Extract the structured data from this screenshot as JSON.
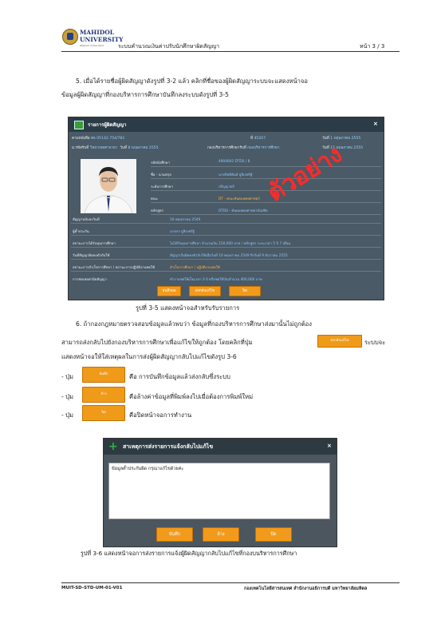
{
  "header": {
    "university_line1": "MAHIDOL",
    "university_line2": "UNIVERSITY",
    "university_tagline": "Wisdom of the Land",
    "doc_title": "ระบบคำนวณเงินค่าปรับนักศึกษาผิดสัญญา",
    "page_number": "หน้า 3 / 3"
  },
  "section5": {
    "line1": "5. เมื่อได้รายชื่อผู้ผิดสัญญาดังรูปที่ 3-2 แล้ว คลิกที่ชื่อของผู้ผิดสัญญาระบบจะแสดงหน้าจอ",
    "line2": "ข้อมูลผู้ผิดสัญญาที่กองบริหารการศึกษาบันทึกลงระบบดังรูปที่ 3-5"
  },
  "dialog1": {
    "title": "รายการผู้ผิดสัญญา",
    "close": "×",
    "doc_label": "ตามหนังสือ",
    "doc_value": "ศธ 05142.754/781",
    "no_label": "ที่",
    "no_value": "45207",
    "date1_label": "วันที่",
    "date1_value": "1 พฤษภาคม 2555",
    "receive_label": "ม.รหัสรับที่",
    "receive_value": "วิทยาเขตศาลายา",
    "date2_label": "วันที่",
    "date2_value": "8 พฤษภาคม 2555",
    "dept_label": "กองบริหารการศึกษารับที่",
    "dept_value": "กองบริหารการศึกษา",
    "date3_label": "วันที่",
    "date3_value": "15 พฤษภาคม 2555",
    "student_rows": [
      {
        "label": "รหัสนักศึกษา",
        "value": "4904002 DTDS / 8"
      },
      {
        "label": "ชื่อ - นามสกุล",
        "value": "นายกิตติพันธ์ ธูสิเกศรัฐ์"
      },
      {
        "label": "ระดับการศึกษา",
        "value": "ปริญญาตรี"
      },
      {
        "label": "คณะ",
        "value": "DT - คณะทันตแพทยศาสตร์"
      },
      {
        "label": "หลักสูตร",
        "value": "DTDS - ทันตแพทยศาสตรบัณฑิต"
      }
    ],
    "contract_rows": [
      {
        "label": "สัญญาฉบับลงวันที่",
        "value": "10 พฤษภาคม 2549"
      },
      {
        "label": "ผู้ค้ำประกัน",
        "value": "นายกร ธูสิเกศรัฐ์"
      },
      {
        "label": "สถานะการได้รับทุนการศึกษา",
        "value": "ไม่ได้รับทุนการศึกษา จำนวนเงิน 150,000 บาท / หลักสูตร ระยะเวลา 5 ปี 7 เดือน"
      },
      {
        "label": "วันที่สัญญาผิดคงตัวกับใช้",
        "value": "สัญญาเริ่มผิดคงตัวกับใช้เมื่อวันที่ 10 พฤษภาคม 2549 ถึงวันที่ 9 ธันวาคม 2555"
      },
      {
        "label": "สถานะการสำเร็จการศึกษา / สถานะการปฏิบัติงานชดใช้",
        "value": "สำเร็จการศึกษา / ปฏิบัติงานชดใช้"
      },
      {
        "label": "การชดเชยค่าผิดสัญญา",
        "value": "ทำงานชดใช้เป็นเวลา 3 ปี หรือชดใช้เงินจำนวน 400,000 บาท"
      }
    ],
    "watermark": "ตัวอย่าง",
    "buttons": {
      "save": "บันทึกผล",
      "return": "ส่งกลับแก้ไข",
      "close": "ปิด"
    }
  },
  "caption35": "รูปที่ 3-5  แสดงหน้าจอสำหรับรับรายการ",
  "section6": {
    "line1": "6. ถ้ากองกฎหมายตรวจสอบข้อมูลแล้วพบว่า ข้อมูลที่กองบริหารการศึกษาส่งมานั้นไม่ถูกต้อง",
    "line2a": "สามารถส่งกลับไปยังกองบริหารการศึกษาเพื่อแก้ไขให้ถูกต้อง โดยคลิกที่ปุ่ม",
    "line2_btn": "ส่งกลับแก้ไข",
    "line2b": "ระบบจะ",
    "line3": "แสดงหน้าจอให้ใส่เหตุผลในการส่งผู้ผิดสัญญากลับไปแก้ไขดังรูป 3-6"
  },
  "bullets": [
    {
      "prefix": "- ปุ่ม",
      "btn": "บันทึก",
      "desc": "คือ การบันทึกข้อมูลแล้วส่งกลับซึ่งระบบ"
    },
    {
      "prefix": "- ปุ่ม",
      "btn": "ล้าง",
      "desc": "คือล้างค่าข้อมูลที่พิมพ์ลงไปเมื่อต้องการพิมพ์ใหม่"
    },
    {
      "prefix": "- ปุ่ม",
      "btn": "ปิด",
      "desc": "คือปิดหน้าจอการทำงาน"
    }
  ],
  "dialog2": {
    "icon": "+",
    "title": "สาเหตุการส่งรายการแจ้งกลับไปแก้ไข",
    "close": "×",
    "reason_text": "ข้อมูลค้ำประกันผิด กรุณาแก้ไขด้วยค่ะ",
    "buttons": {
      "save": "บันทึก",
      "clear": "ล้าง",
      "close": "ปิด"
    }
  },
  "caption36": "รูปที่ 3-6 แสดงหน้าจอการส่งรายการแจ้งผู้ผิดสัญญากลับไปแก้ไขที่กองบนริหารการศึกษา",
  "footer": {
    "doc_code": "MUIT-SD-STD-UM-01-V01",
    "org": "กองเทคโนโลยีสารสนเทศ สำนักงานอธิการบดี มหาวิทยาลัยมหิดล"
  }
}
